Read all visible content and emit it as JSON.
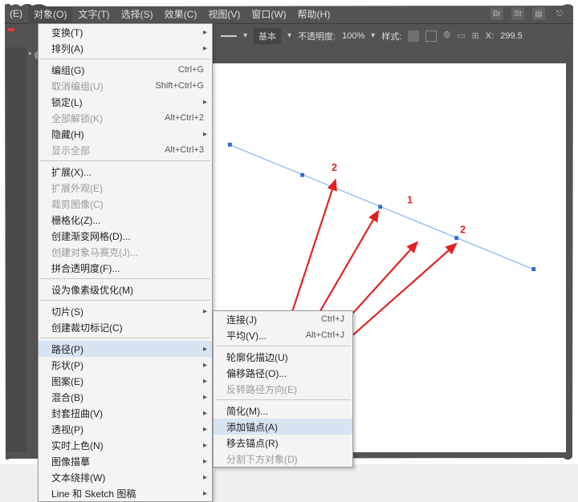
{
  "menubar": {
    "items": [
      "(E)",
      "对象(O)",
      "文字(T)",
      "选择(S)",
      "效果(C)",
      "视图(V)",
      "窗口(W)",
      "帮助(H)"
    ],
    "active_index": 1,
    "icons": [
      "Br",
      "St"
    ]
  },
  "toolbar": {
    "basic_label": "基本",
    "opacity_label": "不透明度:",
    "opacity_value": "100%",
    "style_label": "样式:",
    "x_label": "X:",
    "x_value": "299.5"
  },
  "doc_tab": {
    "suffix": "*  @"
  },
  "object_menu": [
    {
      "label": "变换(T)",
      "arrow": true
    },
    {
      "label": "排列(A)",
      "arrow": true
    },
    {
      "sep": true
    },
    {
      "label": "编组(G)",
      "shortcut": "Ctrl+G"
    },
    {
      "label": "取消编组(U)",
      "shortcut": "Shift+Ctrl+G",
      "disabled": true
    },
    {
      "label": "锁定(L)",
      "arrow": true
    },
    {
      "label": "全部解锁(K)",
      "shortcut": "Alt+Ctrl+2",
      "disabled": true
    },
    {
      "label": "隐藏(H)",
      "arrow": true
    },
    {
      "label": "显示全部",
      "shortcut": "Alt+Ctrl+3",
      "disabled": true
    },
    {
      "sep": true
    },
    {
      "label": "扩展(X)..."
    },
    {
      "label": "扩展外观(E)",
      "disabled": true
    },
    {
      "label": "裁剪图像(C)",
      "disabled": true
    },
    {
      "label": "栅格化(Z)..."
    },
    {
      "label": "创建渐变网格(D)..."
    },
    {
      "label": "创建对象马赛克(J)...",
      "disabled": true
    },
    {
      "label": "拼合透明度(F)..."
    },
    {
      "sep": true
    },
    {
      "label": "设为像素级优化(M)"
    },
    {
      "sep": true
    },
    {
      "label": "切片(S)",
      "arrow": true
    },
    {
      "label": "创建裁切标记(C)"
    },
    {
      "sep": true
    },
    {
      "label": "路径(P)",
      "arrow": true,
      "hover": true
    },
    {
      "label": "形状(P)",
      "arrow": true
    },
    {
      "label": "图案(E)",
      "arrow": true
    },
    {
      "label": "混合(B)",
      "arrow": true
    },
    {
      "label": "封套扭曲(V)",
      "arrow": true
    },
    {
      "label": "透视(P)",
      "arrow": true
    },
    {
      "label": "实时上色(N)",
      "arrow": true
    },
    {
      "label": "图像描摹",
      "arrow": true
    },
    {
      "label": "文本绕排(W)",
      "arrow": true
    },
    {
      "label": "Line 和 Sketch 图稿",
      "arrow": true
    }
  ],
  "path_submenu": [
    {
      "label": "连接(J)",
      "shortcut": "Ctrl+J"
    },
    {
      "label": "平均(V)...",
      "shortcut": "Alt+Ctrl+J"
    },
    {
      "sep": true
    },
    {
      "label": "轮廓化描边(U)"
    },
    {
      "label": "偏移路径(O)..."
    },
    {
      "label": "反转路径方向(E)",
      "disabled": true
    },
    {
      "sep": true
    },
    {
      "label": "简化(M)..."
    },
    {
      "label": "添加锚点(A)",
      "hover": true
    },
    {
      "label": "移去锚点(R)"
    },
    {
      "label": "分割下方对象(D)",
      "disabled": true
    }
  ],
  "canvas_labels": {
    "one": "1",
    "twoA": "2",
    "twoB": "2"
  }
}
